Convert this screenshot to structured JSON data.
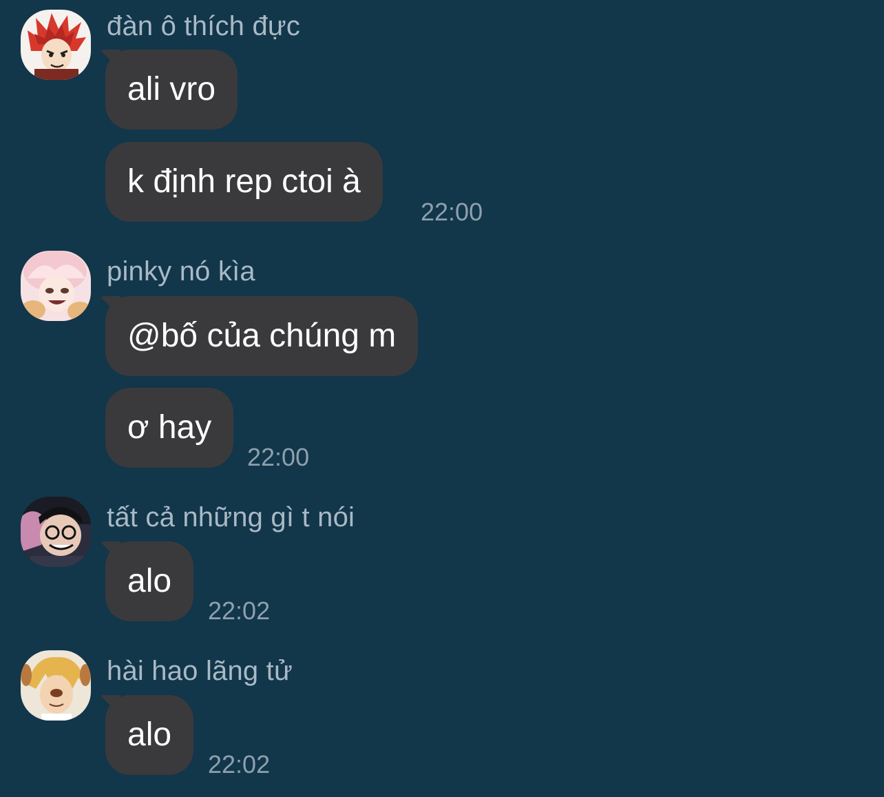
{
  "theme": {
    "background": "#12364a",
    "bubble": "#3a3a3c",
    "sender_color": "#a9b9c5",
    "time_color": "#8ea0ad"
  },
  "messages": [
    {
      "sender": "đàn ô thích đực",
      "avatar_icon": "red-spiky-hair-avatar-icon",
      "bubbles": [
        "ali vro",
        "k định rep ctoi à"
      ],
      "time": "22:00"
    },
    {
      "sender": "pinky nó kìa",
      "avatar_icon": "pink-hair-avatar-icon",
      "bubbles": [
        "@bố của chúng m",
        "ơ hay"
      ],
      "time": "22:00"
    },
    {
      "sender": "tất cả những gì t nói",
      "avatar_icon": "glasses-boy-avatar-icon",
      "bubbles": [
        "alo"
      ],
      "time": "22:02"
    },
    {
      "sender": "hài hao lãng tử",
      "avatar_icon": "blonde-dog-filter-avatar-icon",
      "bubbles": [
        "alo"
      ],
      "time": "22:02"
    }
  ]
}
